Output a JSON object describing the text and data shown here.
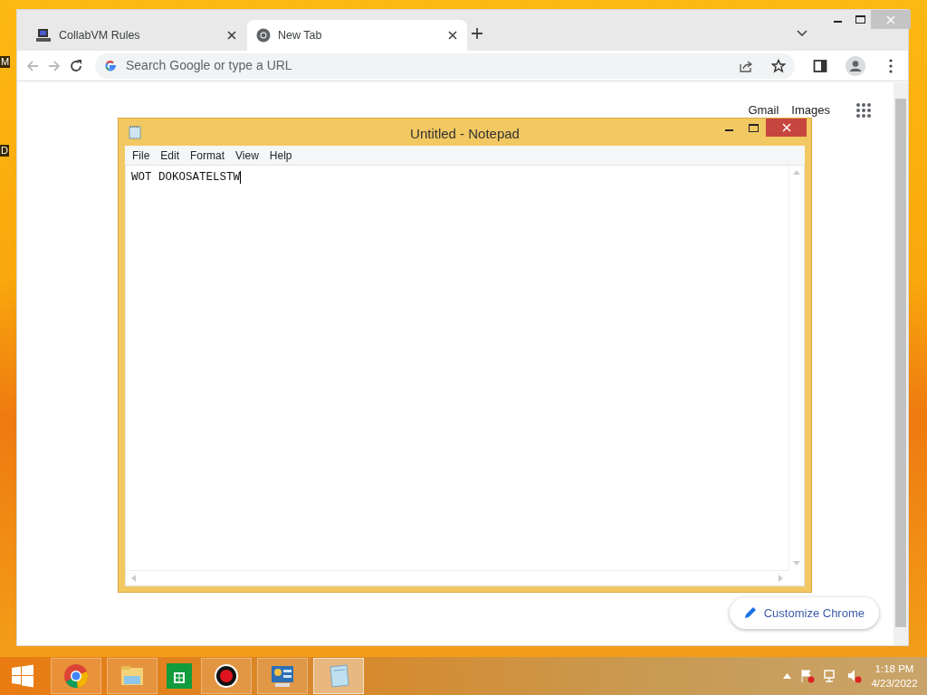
{
  "desktop_labels": [
    "M",
    "D"
  ],
  "browser": {
    "tabs": [
      {
        "title": "CollabVM Rules",
        "kind": "vm",
        "selected": false
      },
      {
        "title": "New Tab",
        "kind": "chrome",
        "selected": true
      }
    ],
    "omnibox": {
      "placeholder": "Search Google or type a URL"
    },
    "links": [
      "Gmail",
      "Images"
    ],
    "customize_button": "Customize Chrome"
  },
  "notepad": {
    "title": "Untitled - Notepad",
    "menu": [
      "File",
      "Edit",
      "Format",
      "View",
      "Help"
    ],
    "text": "WOT DOKOSATELSTW"
  },
  "taskbar": {
    "apps": [
      {
        "kind": "chrome",
        "running": true,
        "selected": false
      },
      {
        "kind": "explorer",
        "running": true,
        "selected": false
      },
      {
        "kind": "store",
        "running": false,
        "selected": false
      },
      {
        "kind": "recorder",
        "running": true,
        "selected": false
      },
      {
        "kind": "control",
        "running": true,
        "selected": false
      },
      {
        "kind": "notepad",
        "running": true,
        "selected": true
      }
    ],
    "time": "1:18 PM",
    "date": "4/23/2022"
  }
}
